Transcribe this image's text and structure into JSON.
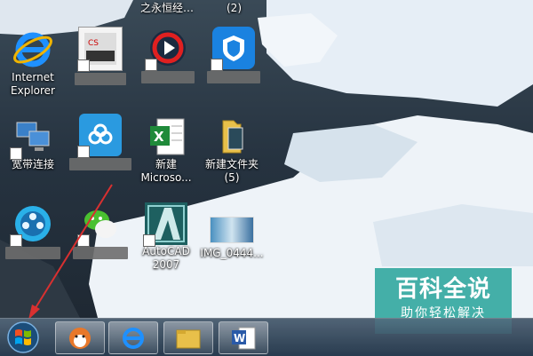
{
  "desktop": {
    "top_labels": [
      "之永恒经…",
      "(2)"
    ],
    "icons": [
      {
        "label_lines": [
          "Internet",
          "Explorer"
        ]
      },
      {
        "label_lines": [],
        "blurred": true
      },
      {
        "label_lines": [],
        "blurred": true
      },
      {
        "label_lines": [],
        "blurred": true
      },
      {
        "label_lines": [
          "宽带连接"
        ]
      },
      {
        "label_lines": [],
        "blurred": true
      },
      {
        "label_lines": [
          "新建",
          "Microso..."
        ]
      },
      {
        "label_lines": [
          "新建文件夹",
          "(5)"
        ]
      },
      {
        "label_lines": [],
        "blurred": true
      },
      {
        "label_lines": [],
        "blurred": true
      },
      {
        "label_lines": [
          "AutoCAD",
          "2007"
        ]
      },
      {
        "label_lines": [
          "IMG_0444..."
        ]
      }
    ]
  },
  "watermark": {
    "title": "百科全说",
    "subtitle": "助你轻松解决"
  },
  "colors": {
    "ie_blue": "#1e90ff",
    "watermark_teal": "#1ea096",
    "arrow_red": "#d83030"
  }
}
